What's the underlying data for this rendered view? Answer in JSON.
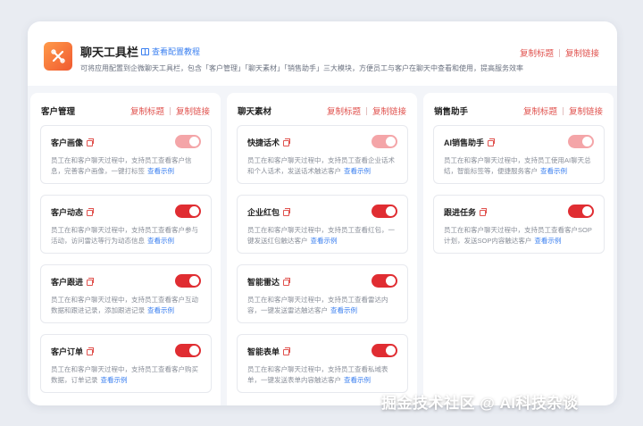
{
  "header": {
    "title": "聊天工具栏",
    "guide_label": "查看配置教程",
    "description": "可将应用配置到企微聊天工具栏，包含「客户管理」「聊天素材」「销售助手」三大模块，方便员工与客户在聊天中查看和使用，提高服务效率",
    "copy_title": "复制标题",
    "copy_link": "复制链接"
  },
  "columns": [
    {
      "title": "客户管理",
      "copy_title": "复制标题",
      "copy_link": "复制链接",
      "cards": [
        {
          "title": "客户画像",
          "desc": "员工在和客户聊天过程中，支持员工查看客户信息，完善客户画像，一键打标签",
          "example": "查看示例",
          "toggle": "on-light"
        },
        {
          "title": "客户动态",
          "desc": "员工在和客户聊天过程中，支持员工查看客户参与活动，访问雷达等行为动态信息",
          "example": "查看示例",
          "toggle": "on"
        },
        {
          "title": "客户跟进",
          "desc": "员工在和客户聊天过程中，支持员工查看客户互动数据和跟进记录，添加跟进记录",
          "example": "查看示例",
          "toggle": "on"
        },
        {
          "title": "客户订单",
          "desc": "员工在和客户聊天过程中，支持员工查看客户购买数据，订单记录",
          "example": "查看示例",
          "toggle": "on"
        }
      ]
    },
    {
      "title": "聊天素材",
      "copy_title": "复制标题",
      "copy_link": "复制链接",
      "cards": [
        {
          "title": "快捷话术",
          "desc": "员工在和客户聊天过程中，支持员工查看企业话术和个人话术，发送话术触达客户",
          "example": "查看示例",
          "toggle": "on-light"
        },
        {
          "title": "企业红包",
          "desc": "员工在和客户聊天过程中，支持员工查看红包，一键发送红包触达客户",
          "example": "查看示例",
          "toggle": "on"
        },
        {
          "title": "智能雷达",
          "desc": "员工在和客户聊天过程中，支持员工查看雷达内容，一键发送雷达触达客户",
          "example": "查看示例",
          "toggle": "on"
        },
        {
          "title": "智能表单",
          "desc": "员工在和客户聊天过程中，支持员工查看私域表单，一键发送表单内容触达客户",
          "example": "查看示例",
          "toggle": "on"
        }
      ]
    },
    {
      "title": "销售助手",
      "copy_title": "复制标题",
      "copy_link": "复制链接",
      "cards": [
        {
          "title": "AI销售助手",
          "desc": "员工在和客户聊天过程中，支持员工使用AI聊天总结，智能标签等，便捷服务客户",
          "example": "查看示例",
          "toggle": "on-light"
        },
        {
          "title": "跟进任务",
          "desc": "员工在和客户聊天过程中，支持员工查看客户SOP计划，发送SOP内容触达客户",
          "example": "查看示例",
          "toggle": "on"
        }
      ]
    }
  ],
  "watermark": "掘金技术社区 @ AI科技杂谈",
  "colors": {
    "accent": "#e02d32",
    "accent_light": "#f4a5a8",
    "link": "#3a7ff0",
    "panel_bg": "#f3f5f9"
  }
}
